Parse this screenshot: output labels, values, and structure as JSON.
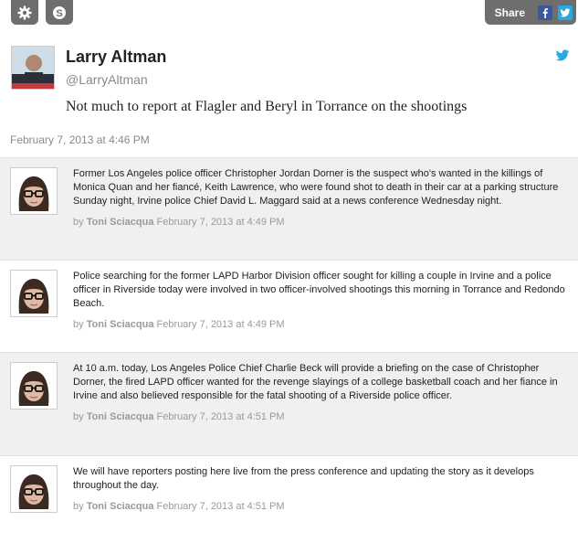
{
  "toolbar": {
    "settings_icon": "gear-icon",
    "second_icon": "s-badge-icon",
    "share_label": "Share",
    "facebook_icon": "facebook-icon",
    "twitter_icon": "twitter-icon",
    "button_color": "#6e6e6e",
    "facebook_color": "#3b5998",
    "twitter_color": "#2aa9e0"
  },
  "tweet": {
    "name": "Larry Altman",
    "handle": "@LarryAltman",
    "text": "Not much to report at Flagler and Beryl in Torrance on the shootings",
    "date": "February 7, 2013 at 4:46 PM",
    "bird_icon": "twitter-bird-icon",
    "bird_color": "#2aa9e0"
  },
  "posts": [
    {
      "text": "Former Los Angeles police officer Christopher Jordan Dorner is the suspect who's wanted in the killings of Monica Quan and her fiancé, Keith Lawrence, who were found shot to death in their car at a parking structure Sunday night, Irvine police Chief David L. Maggard said at a news conference Wednesday night.",
      "by": "by",
      "author": "Toni Sciacqua",
      "time": "February 7, 2013 at 4:49 PM"
    },
    {
      "text": "Police searching for the former LAPD Harbor Division officer sought for killing a couple in Irvine and a police officer in Riverside today were involved in two officer-involved shootings this morning in Torrance and Redondo Beach.",
      "by": "by",
      "author": "Toni Sciacqua",
      "time": "February 7, 2013 at 4:49 PM"
    },
    {
      "text": "At 10 a.m. today, Los Angeles Police Chief Charlie Beck will provide a briefing on the case of Christopher Dorner, the fired LAPD officer wanted for the revenge slayings of a college basketball coach and her fiance in Irvine and also believed responsible for the fatal shooting of a Riverside police officer.",
      "by": "by",
      "author": "Toni Sciacqua",
      "time": "February 7, 2013 at 4:51 PM"
    },
    {
      "text": "We will have reporters posting here live from the press conference and updating the story as it develops throughout the day.",
      "by": "by",
      "author": "Toni Sciacqua",
      "time": "February 7, 2013 at 4:51 PM"
    }
  ]
}
